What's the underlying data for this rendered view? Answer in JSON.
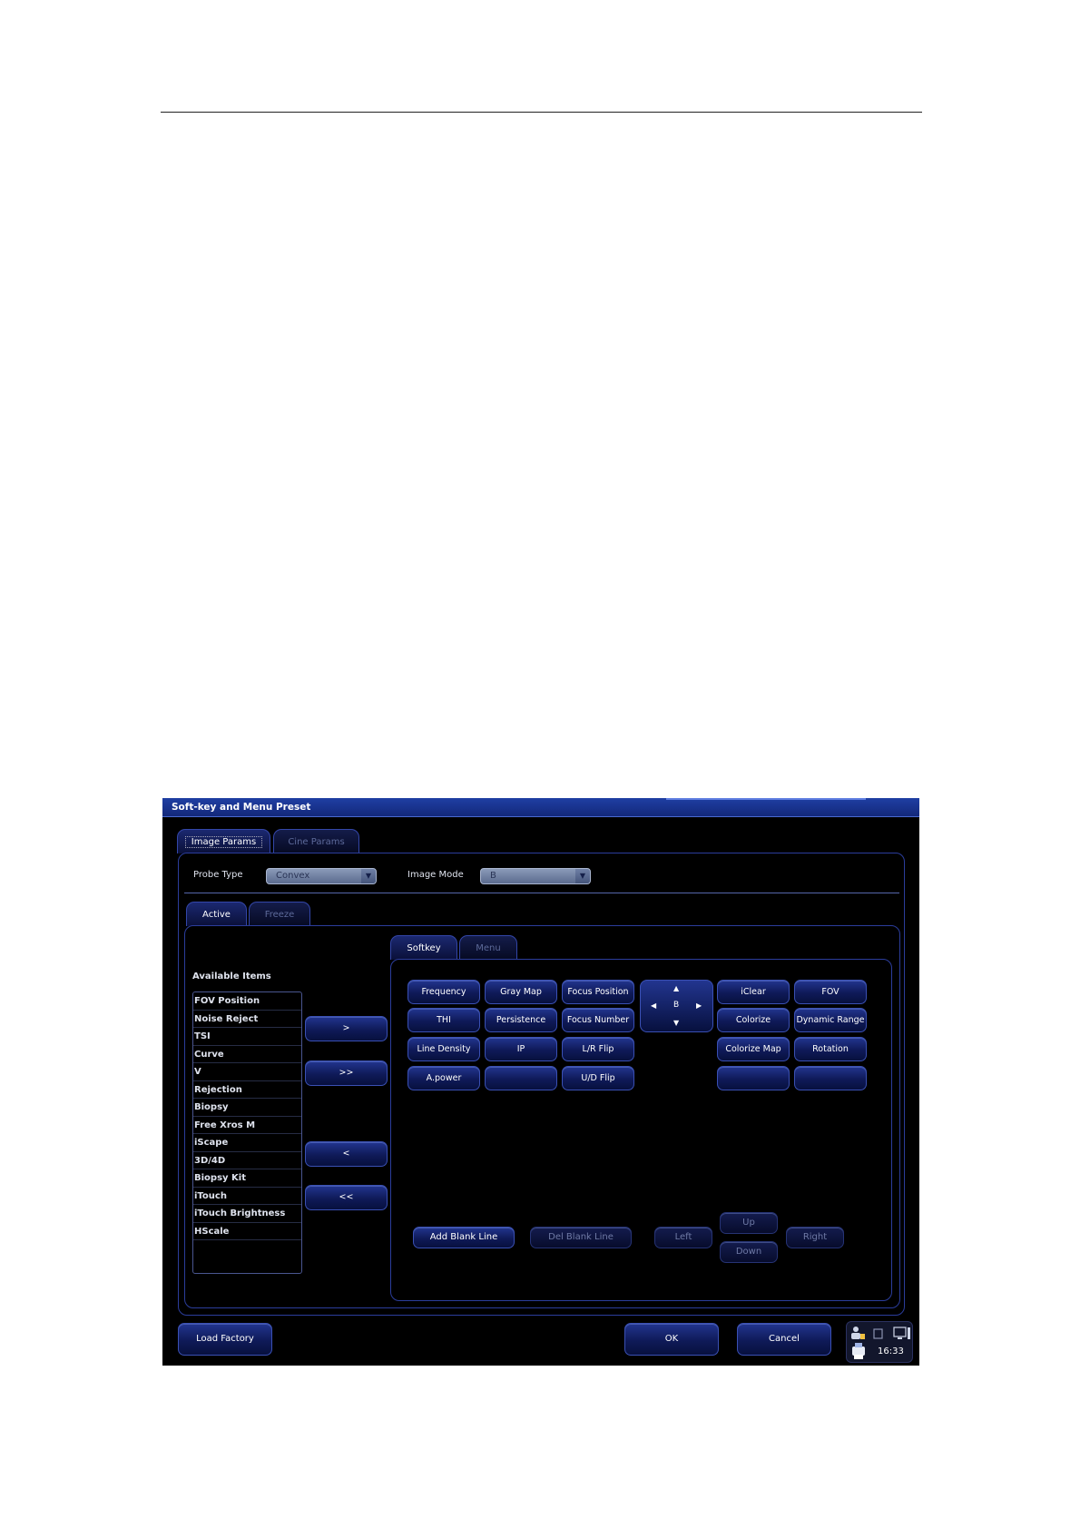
{
  "window": {
    "title": "Soft-key and Menu Preset"
  },
  "top_tabs": [
    {
      "label": "Image Params",
      "active": true
    },
    {
      "label": "Cine Params",
      "active": false
    }
  ],
  "probe": {
    "label": "Probe Type",
    "value": "Convex"
  },
  "mode": {
    "label": "Image Mode",
    "value": "B"
  },
  "state_tabs": [
    {
      "label": "Active",
      "active": true
    },
    {
      "label": "Freeze",
      "active": false
    }
  ],
  "available": {
    "title": "Available Items",
    "items": [
      "FOV Position",
      "Noise Reject",
      "TSI",
      "Curve",
      "V",
      "Rejection",
      "Biopsy",
      "Free Xros M",
      "iScape",
      "3D/4D",
      "Biopsy Kit",
      "iTouch",
      "iTouch Brightness",
      "HScale"
    ]
  },
  "transfer_buttons": {
    "add": ">",
    "add_all": ">>",
    "remove": "<",
    "remove_all": "<<"
  },
  "sk_tabs": [
    {
      "label": "Softkey",
      "active": true
    },
    {
      "label": "Menu",
      "active": false
    }
  ],
  "softkeys": {
    "rows": [
      [
        "Frequency",
        "Gray Map",
        "Focus Position",
        "iClear",
        "FOV"
      ],
      [
        "THI",
        "Persistence",
        "Focus Number",
        "Colorize",
        "Dynamic Range"
      ],
      [
        "Line Density",
        "IP",
        "L/R Flip",
        "Colorize Map",
        "Rotation"
      ],
      [
        "A.power",
        "",
        "U/D Flip",
        "",
        ""
      ]
    ],
    "dpad": {
      "up": "▲",
      "down": "▼",
      "left": "◀",
      "right": "▶",
      "center": "B"
    }
  },
  "edit_buttons": {
    "add_blank": "Add Blank Line",
    "del_blank": "Del Blank Line",
    "left": "Left",
    "up": "Up",
    "down": "Down",
    "right": "Right"
  },
  "footer": {
    "load_factory": "Load Factory",
    "ok": "OK",
    "cancel": "Cancel"
  },
  "status": {
    "time": "16:33"
  },
  "colors": {
    "background": "#000000",
    "titlebar": "#1f3fa3",
    "button": "#0f1a58",
    "border": "#2b3d9c"
  }
}
